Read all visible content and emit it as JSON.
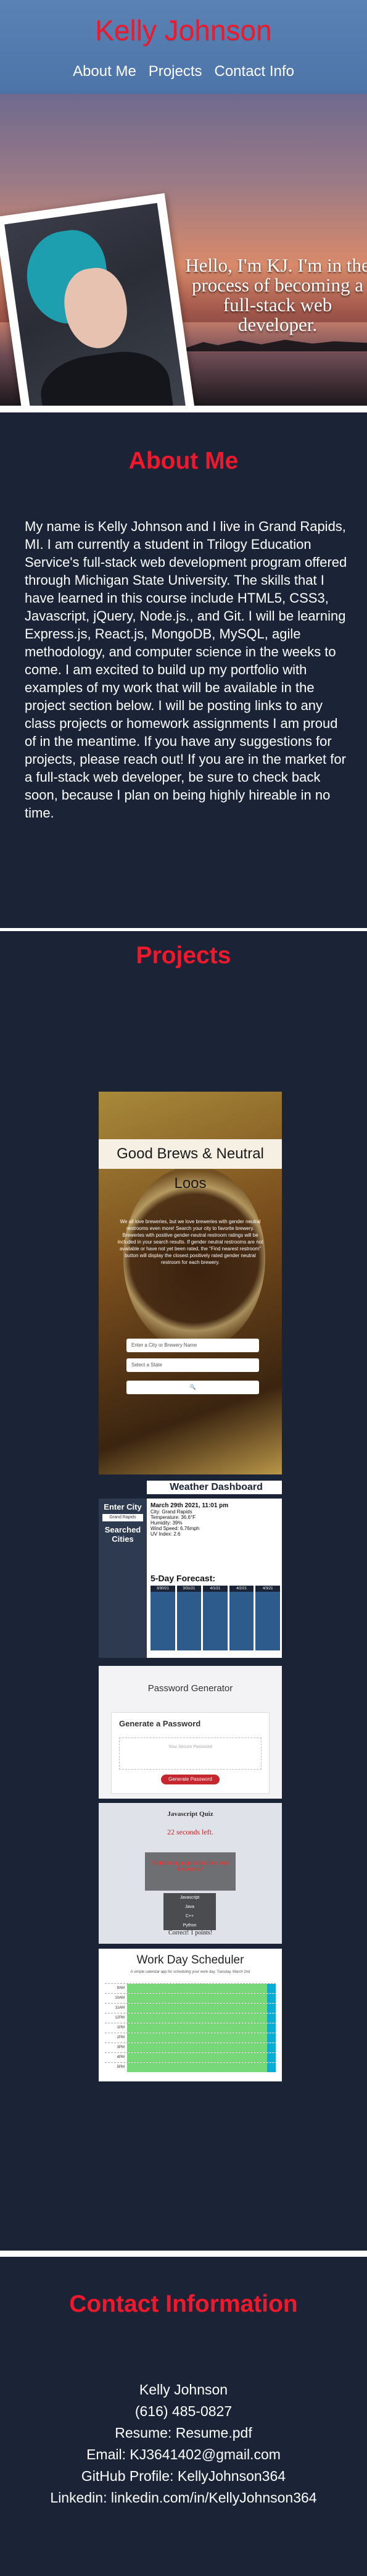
{
  "header": {
    "title": "Kelly Johnson",
    "nav": [
      "About Me",
      "Projects",
      "Contact Info"
    ]
  },
  "hero": {
    "greeting": "Hello, I'm KJ. I'm in the process of becoming a full-stack web developer."
  },
  "about": {
    "title": "About Me",
    "text": "My name is Kelly Johnson and I live in Grand Rapids, MI. I am currently a student in Trilogy Education Service's full-stack web development program offered through Michigan State University. The skills that I have learned in this course include HTML5, CSS3, Javascript, jQuery, Node.js., and Git. I will be learning Express.js, React.js, MongoDB, MySQL, agile methodology, and computer science in the weeks to come. I am excited to build up my portfolio with examples of my work that will be available in the project section below. I will be posting links to any class projects or homework assignments I am proud of in the meantime. If you have any suggestions for projects, please reach out! If you are in the market for a full-stack web developer, be sure to check back soon, because I plan on being highly hireable in no time."
  },
  "projects": {
    "title": "Projects",
    "brews": {
      "title": "Good Brews & Neutral Loos",
      "desc": "We all love breweries, but we love breweries with gender neutral restrooms even more! Search your city to favorite brewery. Breweries with positive gender-neutral restroom ratings will be included in your search results. If gender neutral restrooms are not available or have not yet been rated, the \"Find nearest restroom\" button will display the closest positively rated gender neutral restroom for each brewery.",
      "city_placeholder": "Enter a City or Brewery Name",
      "state_placeholder": "Select a State",
      "search_icon": "search-icon"
    },
    "weather": {
      "title": "Weather Dashboard",
      "enter_city": "Enter City",
      "search_label": "Searched Cities",
      "city_input": "Grand Rapids",
      "date": "March 29th 2021, 11:01 pm",
      "city": "City: Grand Rapids",
      "details": [
        "Temperature: 36.6°F",
        "Humidity: 39%",
        "Wind Speed: 6.76mph",
        "UV Index: 2.6"
      ],
      "forecast_title": "5-Day Forecast:",
      "days": [
        "3/30/21",
        "3/31/21",
        "4/1/21",
        "4/2/21",
        "4/3/21"
      ]
    },
    "password": {
      "title": "Password Generator",
      "box_title": "Generate a Password",
      "placeholder": "Your Secure Password",
      "button": "Generate Password"
    },
    "quiz": {
      "title": "Javascript Quiz",
      "timer": "22 seconds left.",
      "question": "Which language is best for web browsers?",
      "answers": [
        "Javascript",
        "Java",
        "C++",
        "Python"
      ],
      "result": "Correct! 1 points!"
    },
    "scheduler": {
      "title": "Work Day Scheduler",
      "subtitle": "A simple calendar app for scheduling your work day. Tuesday, March 2nd",
      "hours": [
        "9AM",
        "10AM",
        "11AM",
        "12PM",
        "1PM",
        "2PM",
        "3PM",
        "4PM",
        "5PM"
      ]
    }
  },
  "contact": {
    "title": "Contact Information",
    "name": "Kelly Johnson",
    "phone": "(616) 485-0827",
    "resume": "Resume: Resume.pdf",
    "email": "Email: KJ3641402@gmail.com",
    "github": "GitHub Profile: KellyJohnson364",
    "linkedin": "Linkedin: linkedin.com/in/KellyJohnson364"
  },
  "colors": {
    "header_bg": "#4d74a8",
    "accent_red": "#f0182a",
    "section_bg": "#1b2437"
  }
}
